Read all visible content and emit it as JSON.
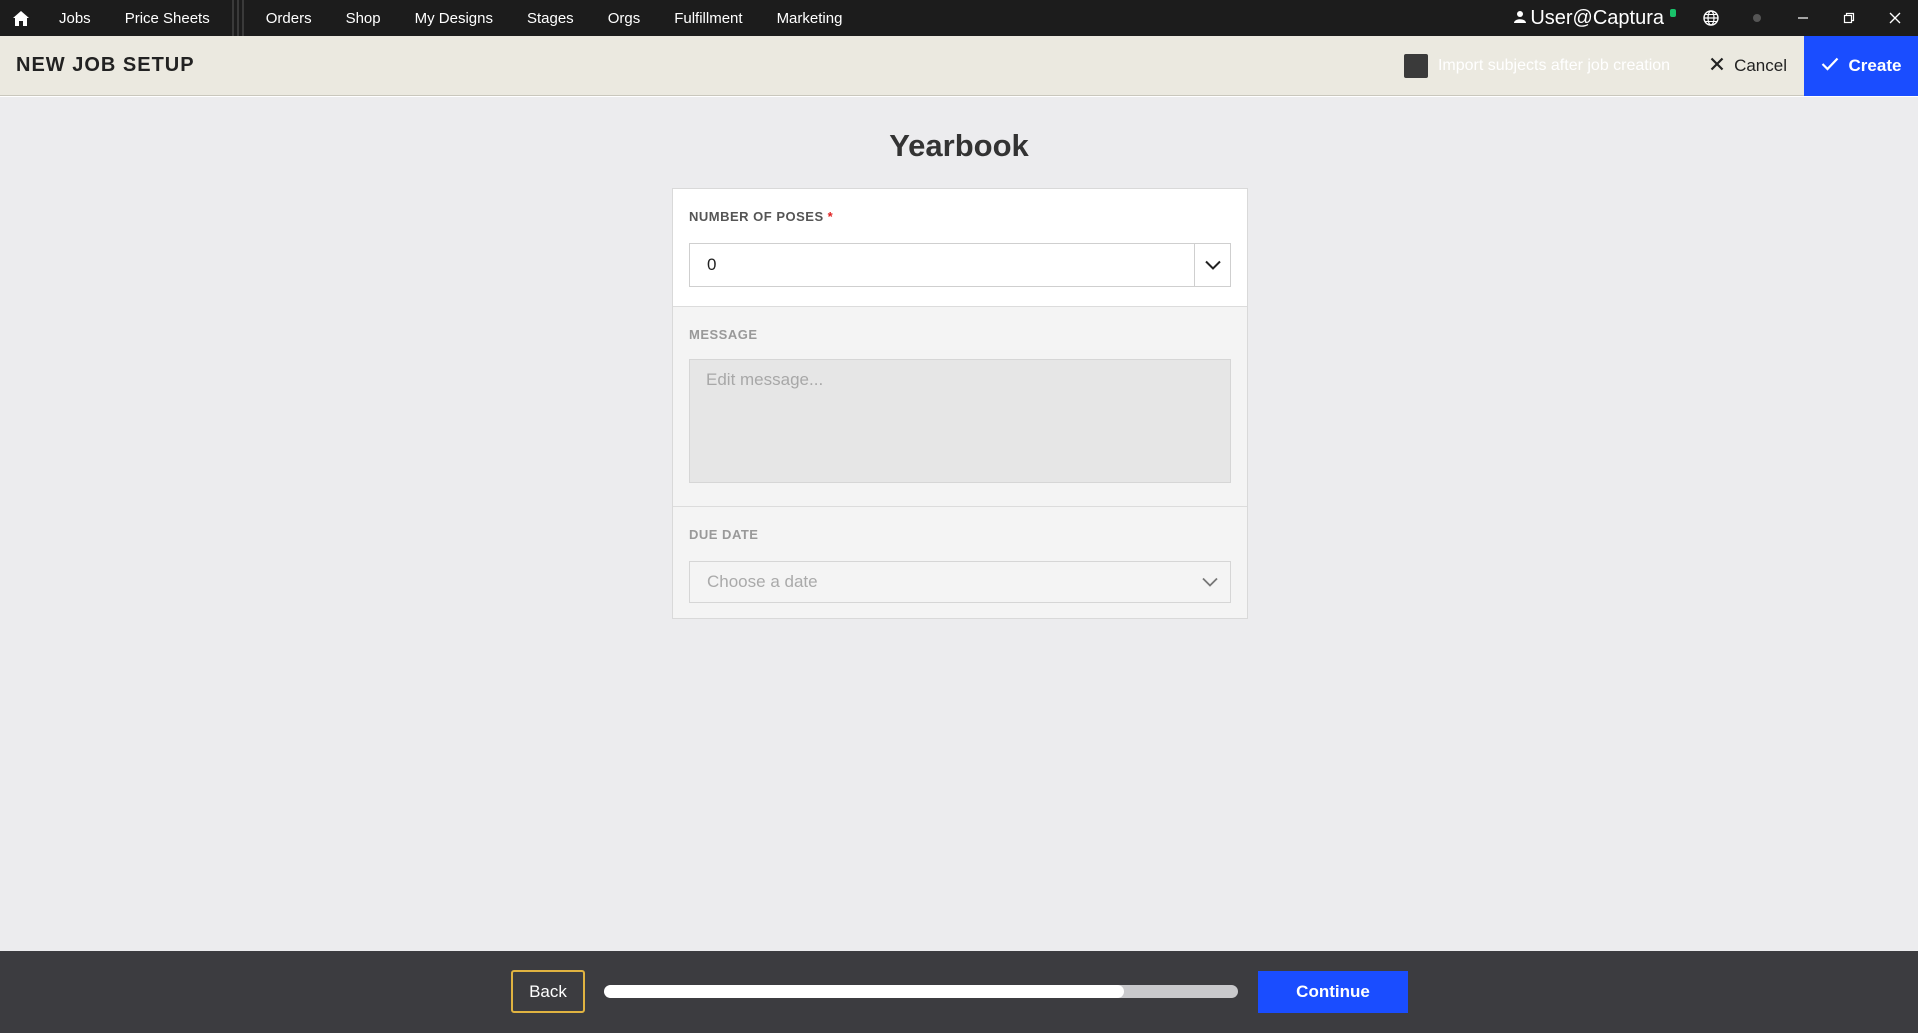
{
  "topnav": {
    "home_icon": "home-icon",
    "items": [
      {
        "label": "Jobs"
      },
      {
        "label": "Price Sheets"
      },
      {
        "label": "Orders"
      },
      {
        "label": "Shop"
      },
      {
        "label": "My Designs"
      },
      {
        "label": "Stages"
      },
      {
        "label": "Orgs"
      },
      {
        "label": "Fulfillment"
      },
      {
        "label": "Marketing"
      }
    ],
    "user": "User@Captura",
    "status_color": "#19c26a"
  },
  "header": {
    "title": "NEW JOB SETUP",
    "import_label": "Import subjects after job creation",
    "cancel_label": "Cancel",
    "create_label": "Create",
    "accent": "#1a4dff"
  },
  "main": {
    "heading": "Yearbook",
    "poses": {
      "label": "NUMBER OF POSES",
      "required_mark": "*",
      "value": "0"
    },
    "message": {
      "label": "MESSAGE",
      "placeholder": "Edit message..."
    },
    "due_date": {
      "label": "DUE DATE",
      "placeholder": "Choose a date"
    }
  },
  "footer": {
    "back_label": "Back",
    "continue_label": "Continue",
    "progress_fraction": 0.82
  }
}
